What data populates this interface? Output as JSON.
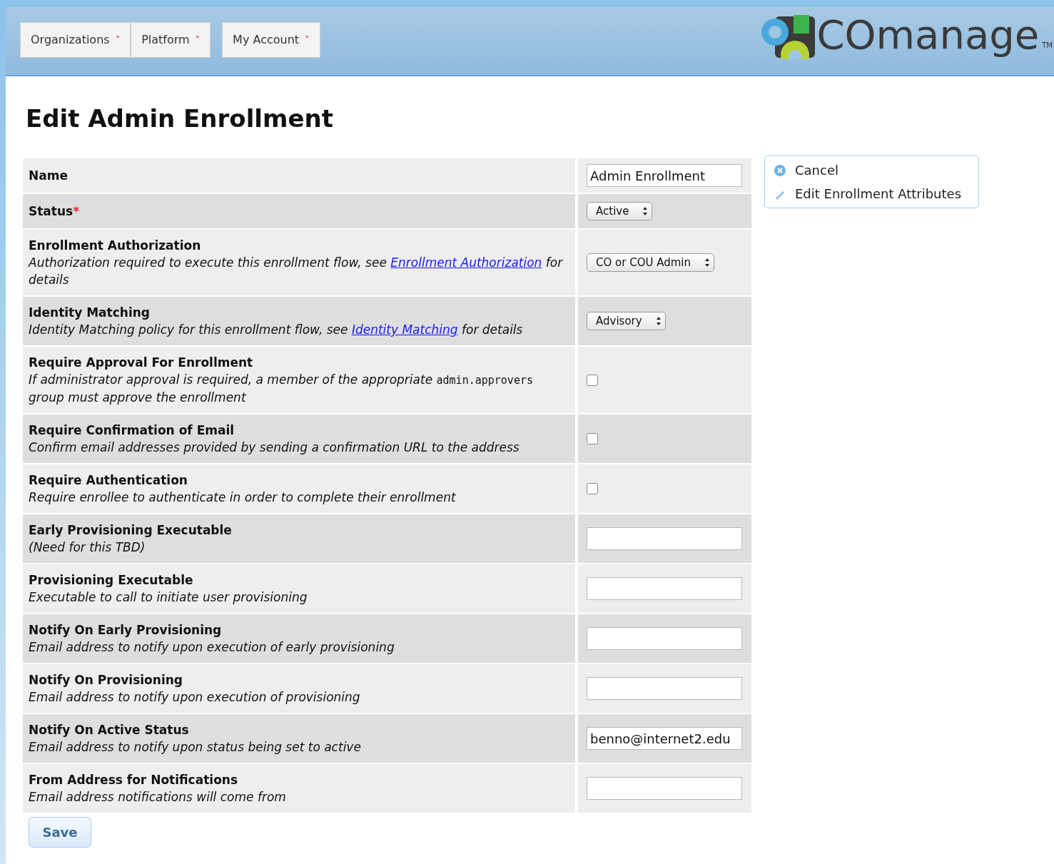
{
  "nav": [
    {
      "label": "Organizations",
      "caret": "˅"
    },
    {
      "label": "Platform",
      "caret": "˅"
    },
    {
      "label": "My Account",
      "caret": "˅"
    }
  ],
  "logo": {
    "text": "COmanage",
    "mark": "TM"
  },
  "title": "Edit Admin Enrollment",
  "fields": [
    {
      "label": "Name",
      "control": {
        "kind": "text",
        "value": "Admin Enrollment"
      }
    },
    {
      "label": "Status",
      "required_mark": "*",
      "control": {
        "kind": "select",
        "value": "Active"
      }
    },
    {
      "label": "Enrollment Authorization",
      "description": [
        {
          "kind": "text",
          "text": "Authorization required to execute this enrollment flow, see "
        },
        {
          "kind": "link",
          "text": "Enrollment Authorization"
        },
        {
          "kind": "text",
          "text": " for details"
        }
      ],
      "control": {
        "kind": "select",
        "value": "CO or COU Admin"
      }
    },
    {
      "label": "Identity Matching",
      "description": [
        {
          "kind": "text",
          "text": "Identity Matching policy for this enrollment flow, see "
        },
        {
          "kind": "link",
          "text": "Identity Matching"
        },
        {
          "kind": "text",
          "text": " for details"
        }
      ],
      "control": {
        "kind": "select",
        "value": "Advisory"
      }
    },
    {
      "label": "Require Approval For Enrollment",
      "description": [
        {
          "kind": "text",
          "text": "If administrator approval is required, a member of the appropriate "
        },
        {
          "kind": "code",
          "text": "admin.approvers"
        },
        {
          "kind": "text",
          "text": " group must approve the enrollment"
        }
      ],
      "control": {
        "kind": "checkbox",
        "checked": false
      }
    },
    {
      "label": "Require Confirmation of Email",
      "description": [
        {
          "kind": "text",
          "text": "Confirm email addresses provided by sending a confirmation URL to the address"
        }
      ],
      "control": {
        "kind": "checkbox",
        "checked": false
      }
    },
    {
      "label": "Require Authentication",
      "description": [
        {
          "kind": "text",
          "text": "Require enrollee to authenticate in order to complete their enrollment"
        }
      ],
      "control": {
        "kind": "checkbox",
        "checked": false
      }
    },
    {
      "label": "Early Provisioning Executable",
      "description": [
        {
          "kind": "text",
          "text": "(Need for this TBD)"
        }
      ],
      "control": {
        "kind": "text"
      }
    },
    {
      "label": "Provisioning Executable",
      "description": [
        {
          "kind": "text",
          "text": "Executable to call to initiate user provisioning"
        }
      ],
      "control": {
        "kind": "text"
      }
    },
    {
      "label": "Notify On Early Provisioning",
      "description": [
        {
          "kind": "text",
          "text": "Email address to notify upon execution of early provisioning"
        }
      ],
      "control": {
        "kind": "text"
      }
    },
    {
      "label": "Notify On Provisioning",
      "description": [
        {
          "kind": "text",
          "text": "Email address to notify upon execution of provisioning"
        }
      ],
      "control": {
        "kind": "text"
      }
    },
    {
      "label": "Notify On Active Status",
      "description": [
        {
          "kind": "text",
          "text": "Email address to notify upon status being set to active"
        }
      ],
      "control": {
        "kind": "text",
        "value": "benno@internet2.edu"
      }
    },
    {
      "label": "From Address for Notifications",
      "description": [
        {
          "kind": "text",
          "text": "Email address notifications will come from"
        }
      ],
      "control": {
        "kind": "text"
      }
    }
  ],
  "actions": [
    {
      "kind": "cancel",
      "label": "Cancel"
    },
    {
      "kind": "edit",
      "label": "Edit Enrollment Attributes"
    }
  ],
  "save_button": "Save"
}
